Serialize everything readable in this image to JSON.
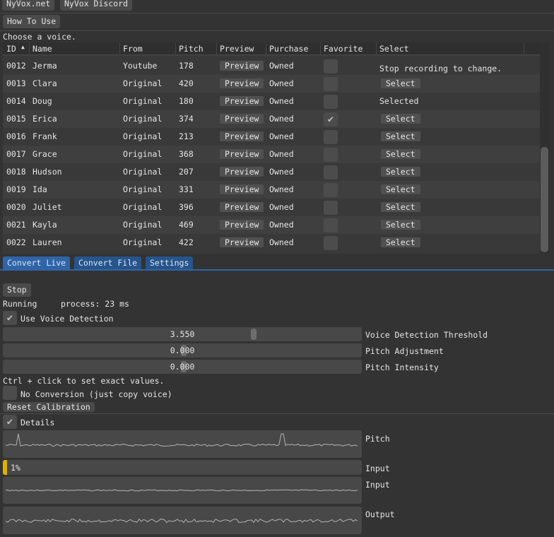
{
  "top_buttons": {
    "site": "NyVox.net",
    "discord": "NyVox Discord",
    "how_to": "How To Use"
  },
  "choose_label": "Choose a voice.",
  "table": {
    "columns": [
      "ID",
      "Name",
      "From",
      "Pitch",
      "Preview",
      "Purchase",
      "Favorite",
      "Select"
    ],
    "sort_indicator": "▲",
    "rows": [
      {
        "id": "0012",
        "name": "Jerma",
        "from": "Youtube",
        "pitch": "178",
        "preview": "Preview",
        "purchase": "Owned",
        "favorite": false,
        "select": "Stop recording to change.",
        "select_type": "text"
      },
      {
        "id": "0013",
        "name": "Clara",
        "from": "Original",
        "pitch": "420",
        "preview": "Preview",
        "purchase": "Owned",
        "favorite": false,
        "select": "Select",
        "select_type": "button"
      },
      {
        "id": "0014",
        "name": "Doug",
        "from": "Original",
        "pitch": "180",
        "preview": "Preview",
        "purchase": "Owned",
        "favorite": false,
        "select": "Selected",
        "select_type": "text"
      },
      {
        "id": "0015",
        "name": "Erica",
        "from": "Original",
        "pitch": "374",
        "preview": "Preview",
        "purchase": "Owned",
        "favorite": true,
        "select": "Select",
        "select_type": "button"
      },
      {
        "id": "0016",
        "name": "Frank",
        "from": "Original",
        "pitch": "213",
        "preview": "Preview",
        "purchase": "Owned",
        "favorite": false,
        "select": "Select",
        "select_type": "button"
      },
      {
        "id": "0017",
        "name": "Grace",
        "from": "Original",
        "pitch": "368",
        "preview": "Preview",
        "purchase": "Owned",
        "favorite": false,
        "select": "Select",
        "select_type": "button"
      },
      {
        "id": "0018",
        "name": "Hudson",
        "from": "Original",
        "pitch": "207",
        "preview": "Preview",
        "purchase": "Owned",
        "favorite": false,
        "select": "Select",
        "select_type": "button"
      },
      {
        "id": "0019",
        "name": "Ida",
        "from": "Original",
        "pitch": "331",
        "preview": "Preview",
        "purchase": "Owned",
        "favorite": false,
        "select": "Select",
        "select_type": "button"
      },
      {
        "id": "0020",
        "name": "Juliet",
        "from": "Original",
        "pitch": "396",
        "preview": "Preview",
        "purchase": "Owned",
        "favorite": false,
        "select": "Select",
        "select_type": "button"
      },
      {
        "id": "0021",
        "name": "Kayla",
        "from": "Original",
        "pitch": "469",
        "preview": "Preview",
        "purchase": "Owned",
        "favorite": false,
        "select": "Select",
        "select_type": "button"
      },
      {
        "id": "0022",
        "name": "Lauren",
        "from": "Original",
        "pitch": "422",
        "preview": "Preview",
        "purchase": "Owned",
        "favorite": false,
        "select": "Select",
        "select_type": "button"
      }
    ]
  },
  "tabs": [
    "Convert Live",
    "Convert File",
    "Settings"
  ],
  "live": {
    "stop": "Stop",
    "status": "Running",
    "process": "process: 23 ms",
    "use_vd": "Use Voice Detection",
    "use_vd_checked": true,
    "sliders": [
      {
        "value": "3.550",
        "label": "Voice Detection Threshold",
        "fraction": 0.7
      },
      {
        "value": "0.000",
        "label": "Pitch Adjustment",
        "fraction": 0.5
      },
      {
        "value": "0.000",
        "label": "Pitch Intensity",
        "fraction": 0.5
      }
    ],
    "hint": "Ctrl + click to set exact values.",
    "no_conversion": "No Conversion (just copy voice)",
    "no_conversion_checked": false,
    "reset": "Reset Calibration",
    "details": "Details",
    "details_checked": true,
    "pitch_label": "Pitch",
    "input_progress": "1%",
    "input_progress_fraction": 0.01,
    "input_label": "Input",
    "input_plot_label": "Input",
    "output_label": "Output",
    "accent": "#e0b000"
  }
}
